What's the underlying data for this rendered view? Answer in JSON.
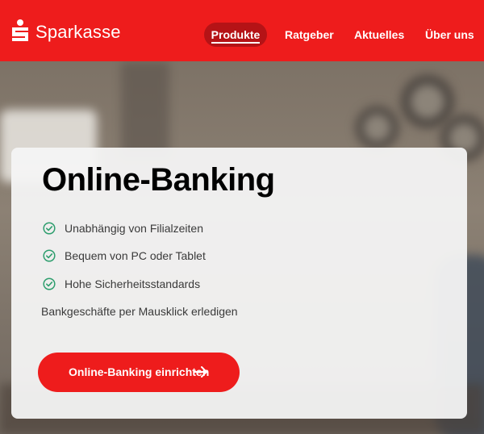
{
  "header": {
    "brand": "Sparkasse",
    "nav": [
      {
        "label": "Produkte",
        "active": true
      },
      {
        "label": "Ratgeber",
        "active": false
      },
      {
        "label": "Aktuelles",
        "active": false
      },
      {
        "label": "Über uns",
        "active": false
      }
    ]
  },
  "hero": {
    "headline": "Online-Banking",
    "features": [
      "Unabhängig von Filialzeiten",
      "Bequem von PC oder Tablet",
      "Hohe Sicherheitsstandards"
    ],
    "subline": "Bankgeschäfte per Mausklick erledigen",
    "cta_label": "Online-Banking einrichten"
  },
  "colors": {
    "brand_red": "#ee1c1c",
    "nav_active_bg": "#b51316",
    "check_green": "#2e9e6e",
    "card_bg": "#f4f4f4"
  },
  "icons": {
    "logo": "sparkasse-s-logo",
    "feature": "check-circle-icon",
    "cta": "arrow-right-icon"
  }
}
